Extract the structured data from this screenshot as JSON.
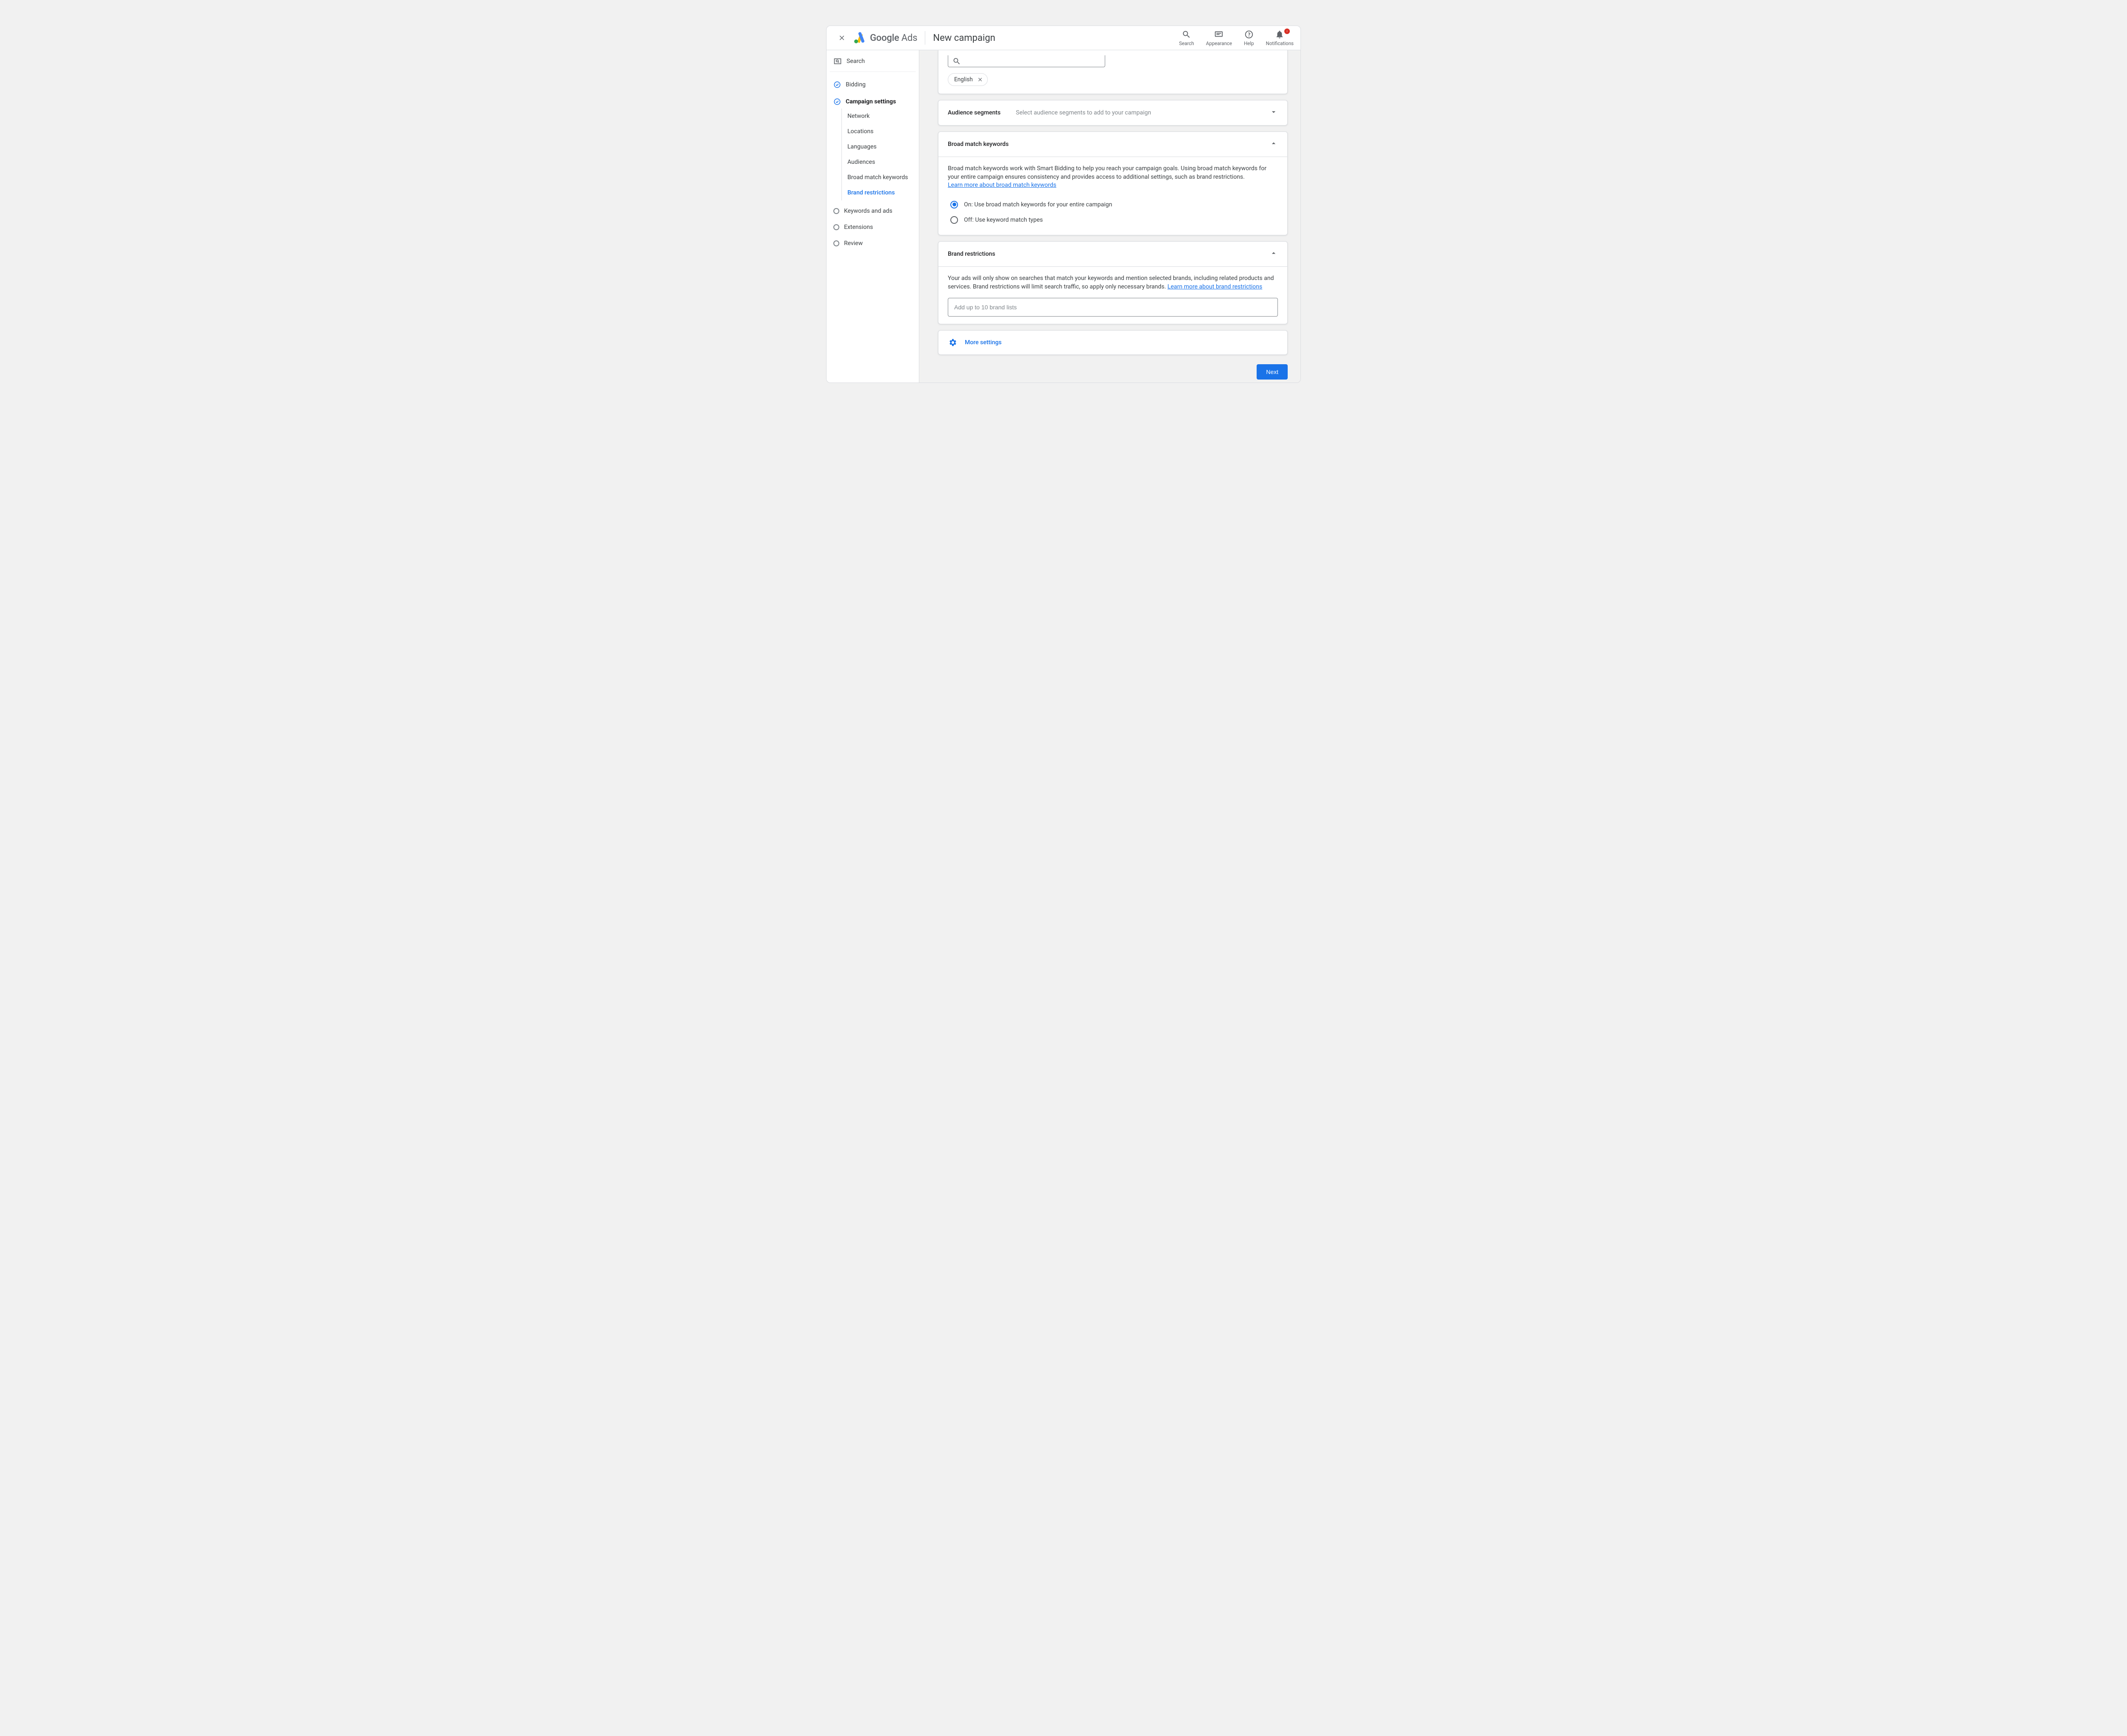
{
  "header": {
    "brand_bold": "Google",
    "brand_light": "Ads",
    "page_title": "New campaign",
    "search_label": "Search",
    "appearance_label": "Appearance",
    "help_label": "Help",
    "notifications_label": "Notifications"
  },
  "sidebar": {
    "search": "Search",
    "bidding": "Bidding",
    "campaign_settings": "Campaign settings",
    "sub": {
      "network": "Network",
      "locations": "Locations",
      "languages": "Languages",
      "audiences": "Audiences",
      "broad_match": "Broad match keywords",
      "brand": "Brand restrictions"
    },
    "keywords_ads": "Keywords and ads",
    "extensions": "Extensions",
    "review": "Review"
  },
  "languages_card": {
    "chip": "English"
  },
  "audience_panel": {
    "title": "Audience segments",
    "hint": "Select audience segments to add to your campaign"
  },
  "broad_panel": {
    "title": "Broad match keywords",
    "desc": "Broad match keywords work with Smart Bidding to help you reach your campaign goals. Using broad match keywords for your entire campaign ensures consistency and provides access to additional settings, such as brand restrictions.",
    "link": "Learn more about broad match keywords",
    "radio_on": "On: Use broad match keywords for your entire campaign",
    "radio_off": "Off: Use keyword match types"
  },
  "brand_panel": {
    "title": "Brand restrictions",
    "desc": "Your ads will only show on searches that match your keywords and mention selected brands, including related products and services. Brand restrictions will limit search traffic, so apply only necessary brands. ",
    "link": "Learn more about brand restrictions",
    "placeholder": "Add up to 10 brand lists"
  },
  "more_settings": "More settings",
  "next": "Next"
}
